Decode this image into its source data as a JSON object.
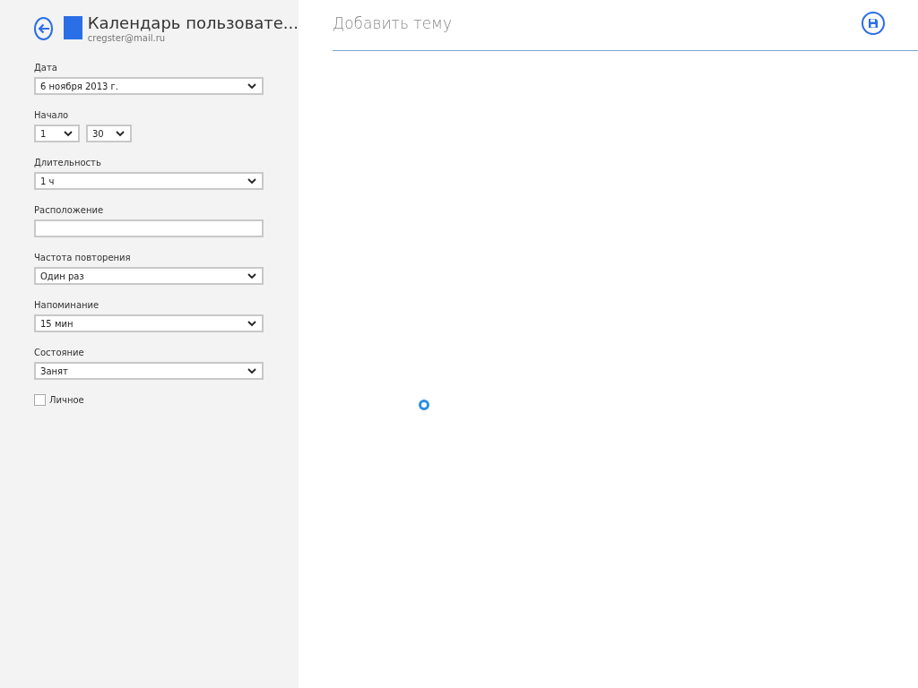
{
  "header": {
    "title": "Календарь пользовате...",
    "account": "cregster@mail.ru",
    "color": "#2b6fe6"
  },
  "fields": [
    {
      "kind": "select",
      "label": "Дата",
      "value": "6 ноября 2013 г."
    },
    {
      "kind": "time",
      "label": "Начало",
      "hour": "1",
      "minute": "30"
    },
    {
      "kind": "select",
      "label": "Длительность",
      "value": "1 ч"
    },
    {
      "kind": "text",
      "label": "Расположение"
    },
    {
      "kind": "select",
      "label": "Частота повторения",
      "value": "Один раз"
    },
    {
      "kind": "select",
      "label": "Напоминание",
      "value": "15 мин"
    },
    {
      "kind": "select",
      "label": "Состояние",
      "value": "Занят"
    }
  ],
  "private": {
    "label": "Личное",
    "checked": false
  },
  "subject": {
    "placeholder": "Добавить тему"
  }
}
